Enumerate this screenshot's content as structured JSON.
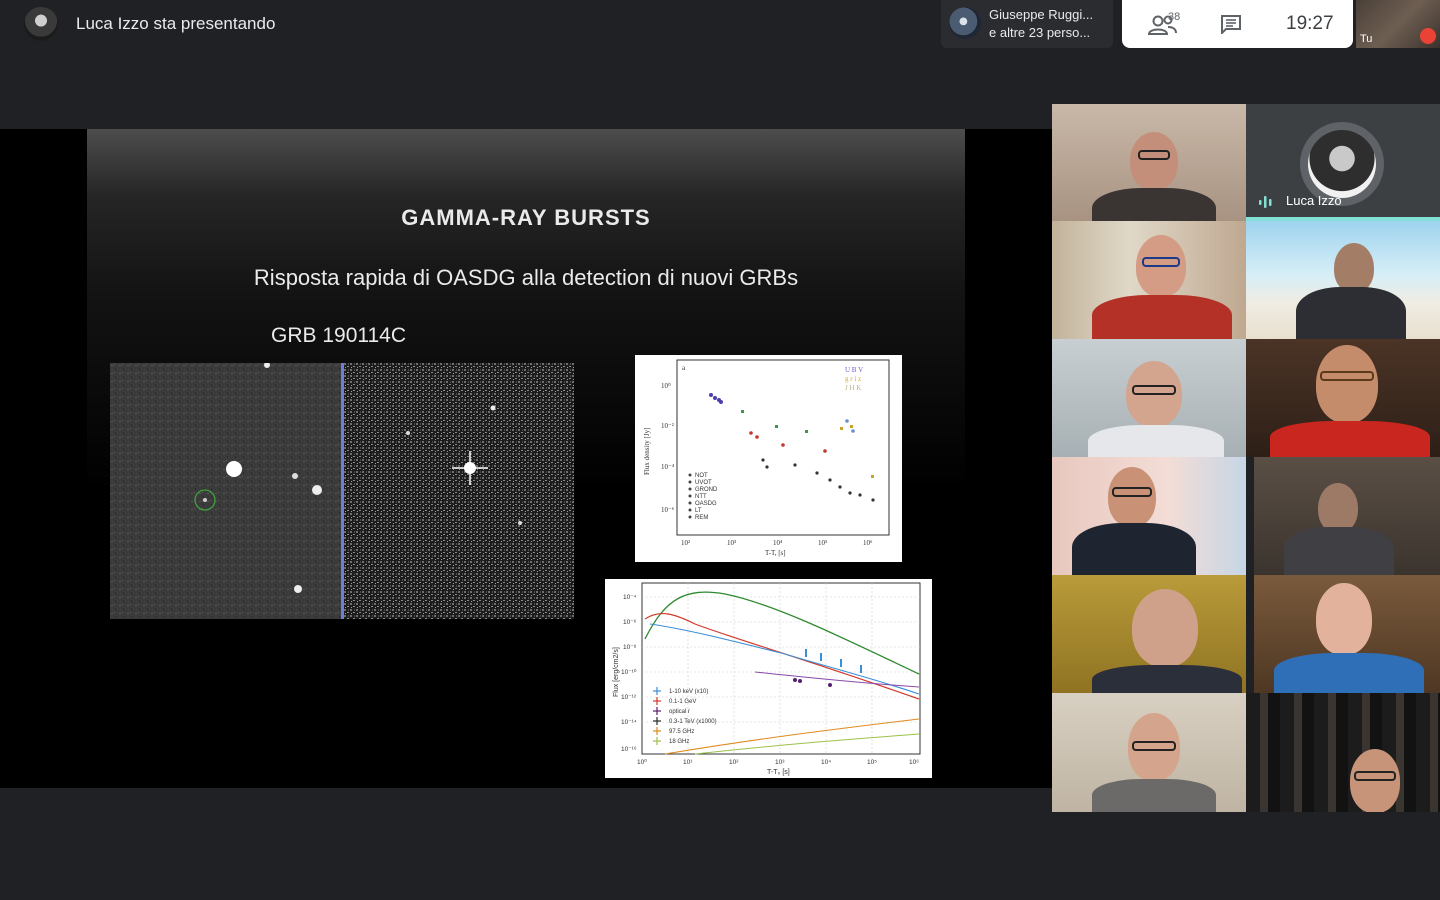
{
  "presenter": {
    "status_text": "Luca Izzo sta presentando"
  },
  "participants_chip": {
    "line1": "Giuseppe Ruggi...",
    "line2": "e altre 23 perso..."
  },
  "controls": {
    "participant_count": "38",
    "time": "19:27"
  },
  "self_view": {
    "label": "Tu"
  },
  "slide": {
    "title": "GAMMA-RAY BURSTS",
    "subtitle": "Risposta rapida di OASDG alla detection di nuovi GRBs",
    "grb_name": "GRB 190114C"
  },
  "plot1": {
    "panel_letter": "a",
    "ylabel": "Flux density [Jy]",
    "xlabel": "T-T, [s]",
    "xticks": [
      "10²",
      "10³",
      "10⁴",
      "10⁵",
      "10⁶"
    ],
    "yticks": [
      "10⁰",
      "10⁻²",
      "10⁻⁴",
      "10⁻⁶"
    ],
    "legend": [
      "NOT",
      "UVOT",
      "GROND",
      "NTT",
      "OASDG",
      "LT",
      "REM"
    ],
    "band_labels": [
      "U B V",
      "g r i z",
      "J H K"
    ]
  },
  "plot2": {
    "ylabel": "Flux [erg/cm2/s]",
    "xlabel": "T-T₀ [s]",
    "xticks": [
      "10⁰",
      "10¹",
      "10²",
      "10³",
      "10⁴",
      "10⁵",
      "10⁶"
    ],
    "yticks": [
      "10⁻⁴",
      "10⁻⁶",
      "10⁻⁸",
      "10⁻¹⁰",
      "10⁻¹²",
      "10⁻¹⁴",
      "10⁻¹⁶"
    ],
    "legend": [
      "1-10 keV (x10)",
      "0.1-1 GeV",
      "optical r",
      "0.3-1 TeV (x1000)",
      "97.5 GHz",
      "18 GHz"
    ],
    "legend_colors": [
      "#3b8fd9",
      "#d23a2a",
      "#5a1f6e",
      "#2a2a2a",
      "#e08a1e",
      "#9bc24a"
    ]
  },
  "speaker_tile": {
    "name": "Luca Izzo"
  },
  "colors": {
    "speaking": "#82e0d6",
    "mic_off": "#ea4335",
    "background": "#202124"
  }
}
